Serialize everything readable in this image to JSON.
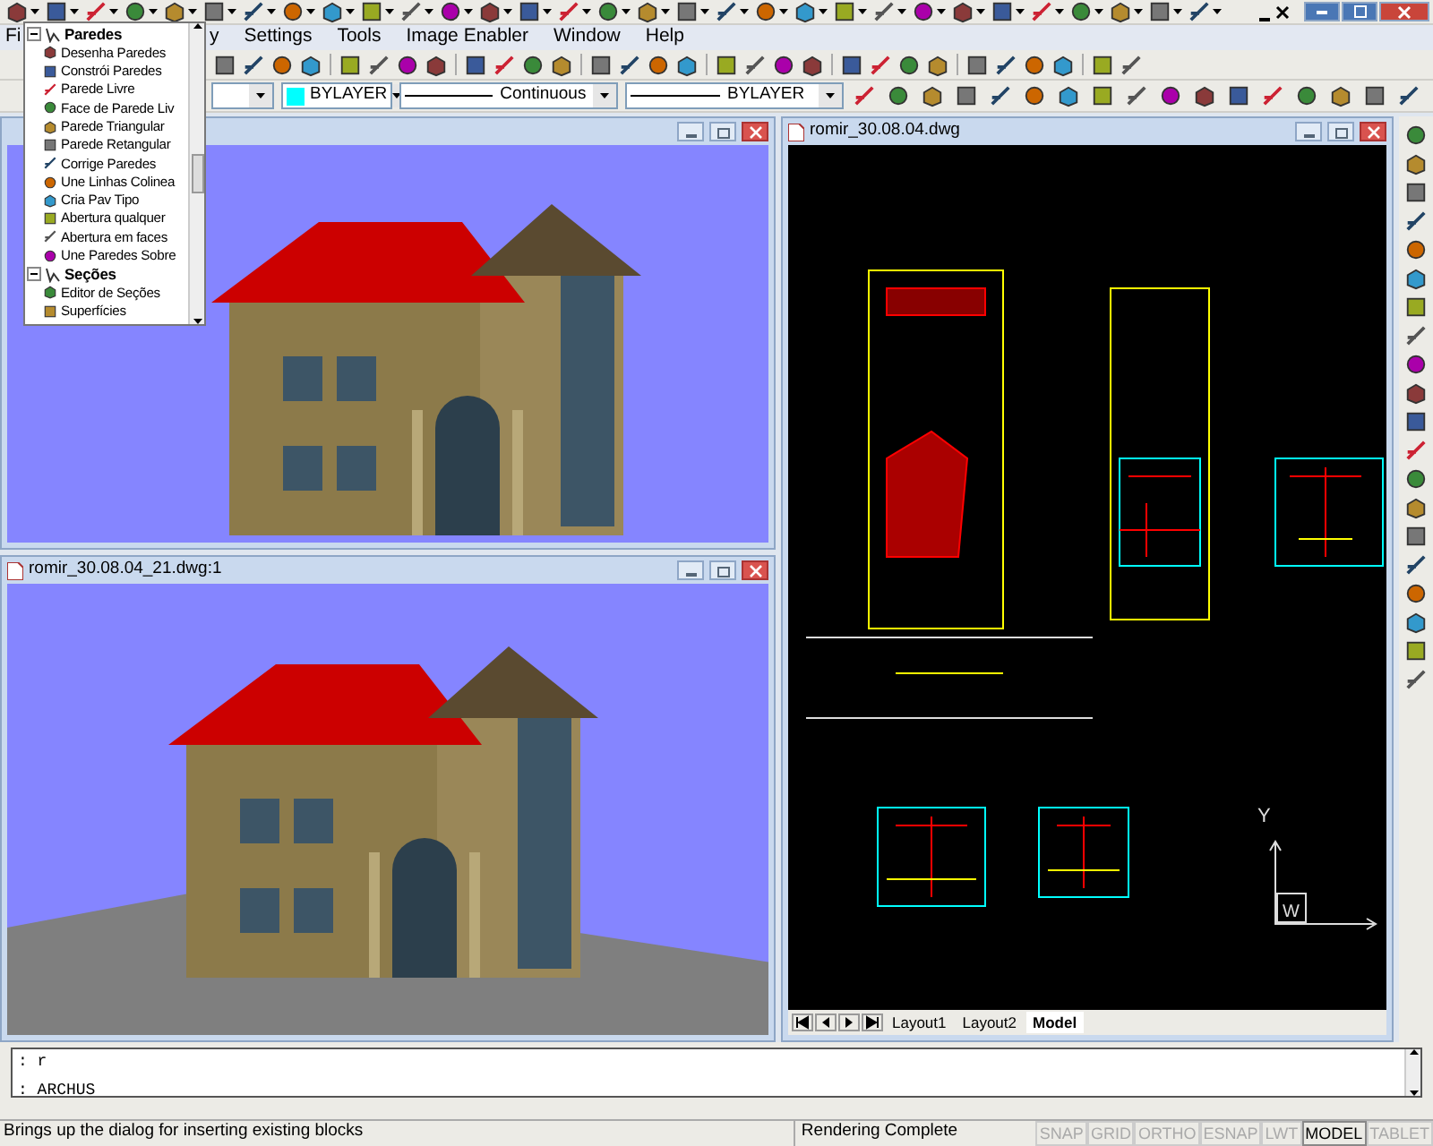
{
  "menu_bar": [
    {
      "label": "Fi"
    },
    {
      "label": "y"
    },
    {
      "label": "Settings"
    },
    {
      "label": "Tools"
    },
    {
      "label": "Image Enabler"
    },
    {
      "label": "Window"
    },
    {
      "label": "Help"
    }
  ],
  "properties": {
    "layer_color": {
      "label": "BYLAYER",
      "color": "#00ffff"
    },
    "linetype": "Continuous",
    "lineweight": "BYLAYER"
  },
  "tree_popup": {
    "groups": [
      {
        "label": "Paredes",
        "expanded": true,
        "children": [
          {
            "label": "Desenha Paredes"
          },
          {
            "label": "Constrói Paredes"
          },
          {
            "label": "Parede Livre"
          },
          {
            "label": "Face de Parede Liv"
          },
          {
            "label": "Parede Triangular"
          },
          {
            "label": "Parede Retangular"
          },
          {
            "label": "Corrige Paredes"
          },
          {
            "label": "Une Linhas Colinea"
          },
          {
            "label": "Cria Pav Tipo"
          },
          {
            "label": "Abertura qualquer"
          },
          {
            "label": "Abertura em faces"
          },
          {
            "label": "Une Paredes Sobre"
          }
        ]
      },
      {
        "label": "Seções",
        "expanded": true,
        "children": [
          {
            "label": "Editor de Seções"
          },
          {
            "label": "Superfícies"
          }
        ]
      }
    ]
  },
  "render_window_bottom": {
    "title": "romir_30.08.04_21.dwg:1"
  },
  "drawing_window": {
    "title": "romir_30.08.04.dwg",
    "axis_labels": [
      "Y",
      "W"
    ],
    "tabs": [
      {
        "label": "Layout1",
        "selected": false
      },
      {
        "label": "Layout2",
        "selected": false
      },
      {
        "label": "Model",
        "selected": true
      }
    ]
  },
  "command_line": {
    "lines": [
      ": r",
      ": ARCHUS"
    ]
  },
  "status_bar": {
    "message": "Brings up the dialog for inserting existing blocks",
    "state": "Rendering Complete",
    "toggles": [
      {
        "label": "SNAP",
        "on": false
      },
      {
        "label": "GRID",
        "on": false
      },
      {
        "label": "ORTHO",
        "on": false
      },
      {
        "label": "ESNAP",
        "on": false
      },
      {
        "label": "LWT",
        "on": false
      },
      {
        "label": "MODEL",
        "on": true
      },
      {
        "label": "TABLET",
        "on": false
      }
    ]
  }
}
